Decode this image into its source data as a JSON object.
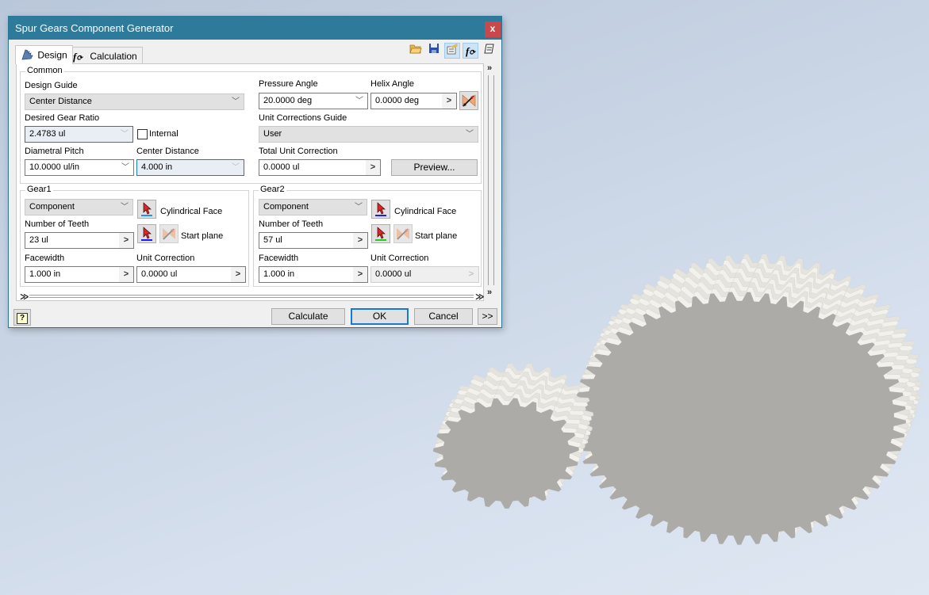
{
  "dialog": {
    "title": "Spur Gears Component Generator",
    "close_label": "x",
    "tabs": [
      {
        "label": "Design",
        "icon": "gear-icon",
        "active": true
      },
      {
        "label": "Calculation",
        "icon": "function-icon",
        "active": false
      }
    ],
    "toolbar": [
      {
        "name": "open-folder-icon"
      },
      {
        "name": "save-icon"
      },
      {
        "name": "results-icon",
        "pressed": true
      },
      {
        "name": "calculation-function-icon",
        "pressed": true
      },
      {
        "name": "notes-icon"
      }
    ],
    "common": {
      "group_label": "Common",
      "design_guide": {
        "label": "Design Guide",
        "value": "Center Distance"
      },
      "desired_gear_ratio": {
        "label": "Desired Gear Ratio",
        "value": "2.4783 ul"
      },
      "internal": {
        "label": "Internal",
        "checked": false
      },
      "diametral_pitch": {
        "label": "Diametral Pitch",
        "value": "10.0000 ul/in"
      },
      "center_distance": {
        "label": "Center Distance",
        "value": "4.000 in"
      },
      "pressure_angle": {
        "label": "Pressure Angle",
        "value": "20.0000 deg"
      },
      "helix_angle": {
        "label": "Helix Angle",
        "value": "0.0000 deg"
      },
      "unit_corrections_guide": {
        "label": "Unit Corrections Guide",
        "value": "User"
      },
      "total_unit_correction": {
        "label": "Total Unit Correction",
        "value": "0.0000 ul"
      },
      "preview_label": "Preview..."
    },
    "gear1": {
      "group_label": "Gear1",
      "type": "Component",
      "cylindrical_face_label": "Cylindrical Face",
      "start_plane_label": "Start plane",
      "teeth_label": "Number of Teeth",
      "teeth_value": "23 ul",
      "facewidth_label": "Facewidth",
      "facewidth_value": "1.000 in",
      "unit_correction_label": "Unit Correction",
      "unit_correction_value": "0.0000 ul",
      "face_color": "#1e90ff",
      "plane_color": "#1a1aff"
    },
    "gear2": {
      "group_label": "Gear2",
      "type": "Component",
      "cylindrical_face_label": "Cylindrical Face",
      "start_plane_label": "Start plane",
      "teeth_label": "Number of Teeth",
      "teeth_value": "57 ul",
      "facewidth_label": "Facewidth",
      "facewidth_value": "1.000 in",
      "unit_correction_label": "Unit Correction",
      "unit_correction_value": "0.0000 ul",
      "face_color": "#1a1aff",
      "plane_color": "#22cc22"
    },
    "buttons": {
      "help": "?",
      "calculate": "Calculate",
      "ok": "OK",
      "cancel": "Cancel",
      "more": ">>"
    }
  },
  "scene": {
    "gear_small_teeth": 23,
    "gear_large_teeth": 57,
    "face_color": "#acaba7",
    "flank_color": "#f2f1ec"
  }
}
